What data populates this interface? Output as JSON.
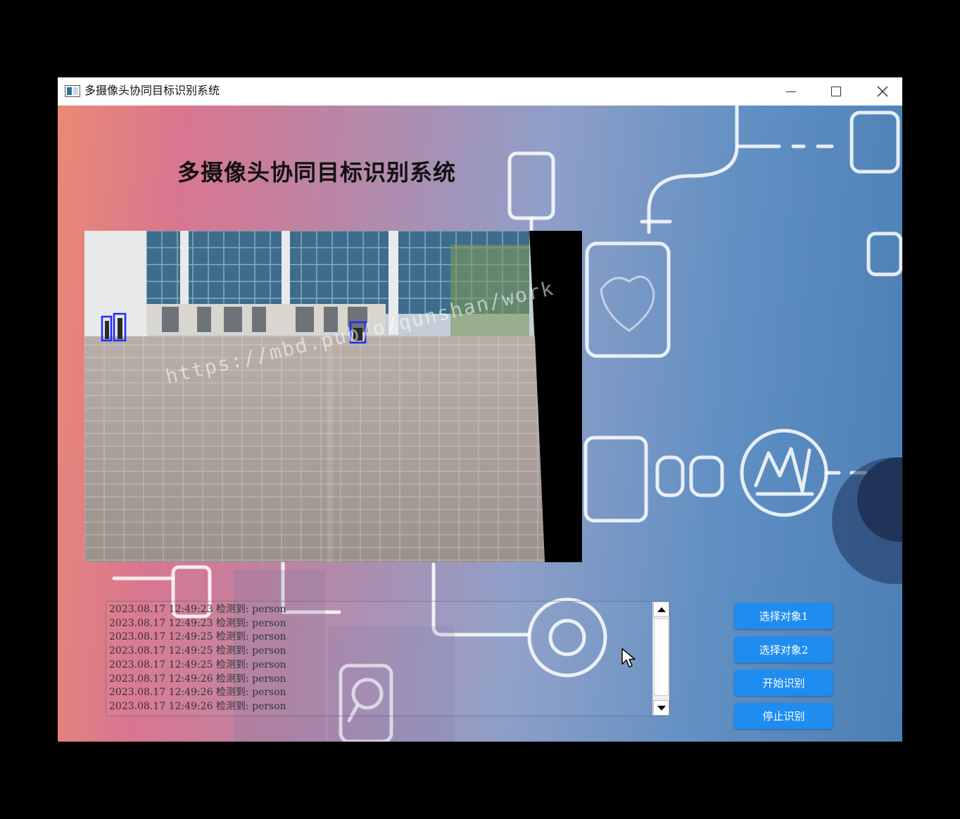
{
  "window": {
    "title": "多摄像头协同目标识别系统",
    "controls": {
      "minimize": "minimize-icon",
      "maximize": "maximize-icon",
      "close": "close-icon"
    }
  },
  "main": {
    "title": "多摄像头协同目标识别系统",
    "watermark": "https://mbd.pub/o/qunshan/work"
  },
  "camera": {
    "detection_color": "#1e2cff"
  },
  "log": {
    "entries": [
      "2023.08.17 12:49:23 检测到: person",
      "2023.08.17 12:49:23 检测到: person",
      "2023.08.17 12:49:25 检测到: person",
      "2023.08.17 12:49:25 检测到: person",
      "2023.08.17 12:49:25 检测到: person",
      "2023.08.17 12:49:26 检测到: person",
      "2023.08.17 12:49:26 检测到: person",
      "2023.08.17 12:49:26 检测到: person"
    ]
  },
  "actions": {
    "select_1": "选择对象1",
    "select_2": "选择对象2",
    "start": "开始识别",
    "stop": "停止识别"
  },
  "colors": {
    "accent": "#1f8cf0",
    "title_text": "#111111"
  }
}
